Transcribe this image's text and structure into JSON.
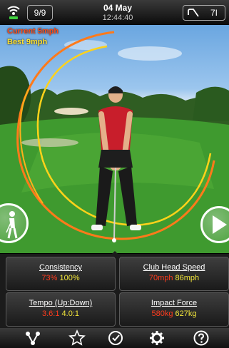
{
  "topbar": {
    "counter": "9/9",
    "date": "04 May",
    "time": "12:44:40",
    "club": "7I"
  },
  "overlay": {
    "current_speed": "Current  5mph",
    "best_speed": "Best  9mph"
  },
  "stats": [
    {
      "title": "Consistency",
      "value1": "73%",
      "value2": "100%"
    },
    {
      "title": "Club Head Speed",
      "value1": "70mph",
      "value2": "86mph"
    },
    {
      "title": "Tempo (Up:Down)",
      "value1": "3.6:1",
      "value2": "4.0:1"
    },
    {
      "title": "Impact Force",
      "value1": "580kg",
      "value2": "627kg"
    }
  ],
  "icons": {
    "signal": "signal-icon",
    "club": "golf-club-icon",
    "golfer": "golfer-icon",
    "play": "play-icon",
    "share": "share-icon",
    "favorite": "star-icon",
    "history": "clock-check-icon",
    "settings": "gear-icon",
    "help": "help-icon"
  },
  "colors": {
    "current": "#ff4d1a",
    "best": "#ffe233",
    "value_primary": "#ff3b1d",
    "value_secondary": "#f2e53a"
  }
}
